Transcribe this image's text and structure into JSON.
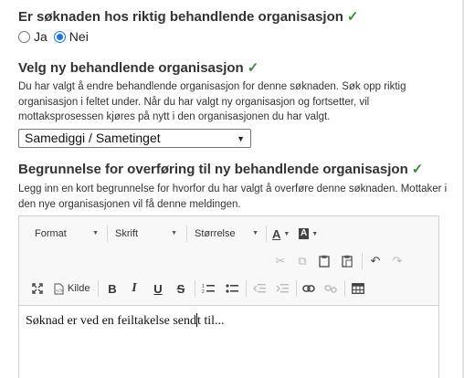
{
  "q1": {
    "title": "Er søknaden hos riktig behandlende organisasjon",
    "check": "✓",
    "options": [
      {
        "label": "Ja",
        "selected": false
      },
      {
        "label": "Nei",
        "selected": true
      }
    ]
  },
  "q2": {
    "title": "Velg ny behandlende organisasjon",
    "check": "✓",
    "help": "Du har valgt å endre behandlende organisasjon for denne søknaden. Søk opp riktig organisasjon i feltet under. Når du har valgt ny organisasjon og fortsetter, vil mottaksprosessen kjøres på nytt i den organisasjonen du har valgt.",
    "selected_value": "Samediggi / Sametinget"
  },
  "q3": {
    "title": "Begrunnelse for overføring til ny behandlende organisasjon",
    "check": "✓",
    "help": "Legg inn en kort begrunnelse for hvorfor du har valgt å overføre denne søknaden. Mottaker i den nye organisasjonen vil få denne meldingen."
  },
  "editor": {
    "format_label": "Format",
    "font_label": "Skrift",
    "size_label": "Størrelse",
    "source_label": "Kilde",
    "bold": "B",
    "italic": "I",
    "underline": "U",
    "strike": "S",
    "text_color": "A",
    "bg_color": "A",
    "content_before_cursor": "Søknad er ved en feiltakelse send",
    "content_after_cursor": "t til..."
  },
  "colors": {
    "check": "#3c8a3c",
    "radio_accent": "#1a73e8",
    "toolbar_bg": "#f8f8f8"
  }
}
